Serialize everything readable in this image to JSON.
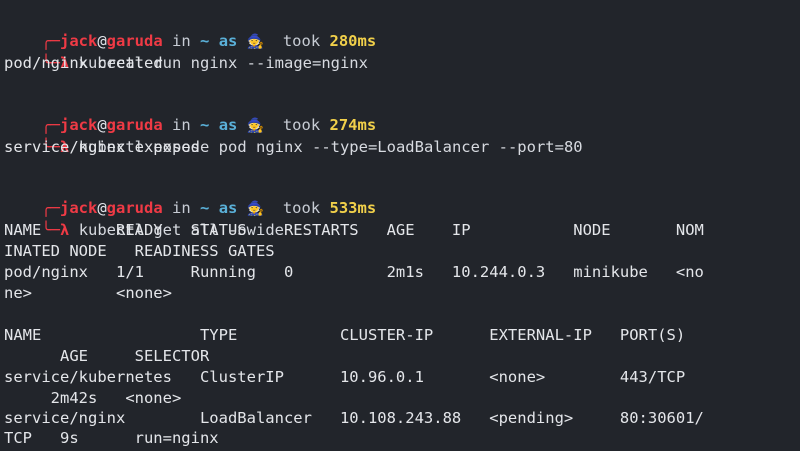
{
  "prompt": {
    "top_corner": "╭─",
    "bot_corner": "╰─",
    "user": "jack",
    "at": "@",
    "host": "garuda",
    "in_label": "in",
    "path": "~",
    "as_label": "as",
    "emoji": "🧙",
    "took_label": "took",
    "symbol": "λ"
  },
  "blocks": [
    {
      "duration": "280ms",
      "command": "kubectl run nginx --image=nginx",
      "output": [
        "pod/nginx created"
      ]
    },
    {
      "duration": "274ms",
      "command": "kubectl expose pod nginx --type=LoadBalancer --port=80",
      "output": [
        "service/nginx exposed"
      ]
    },
    {
      "duration": "533ms",
      "command": "kubectl get all -owide",
      "output": [
        "NAME        READY   STATUS    RESTARTS   AGE    IP           NODE       NOM",
        "INATED NODE   READINESS GATES",
        "pod/nginx   1/1     Running   0          2m1s   10.244.0.3   minikube   <no",
        "ne>         <none>",
        "",
        "NAME                 TYPE           CLUSTER-IP      EXTERNAL-IP   PORT(S)",
        "      AGE     SELECTOR",
        "service/kubernetes   ClusterIP      10.96.0.1       <none>        443/TCP",
        "     2m42s   <none>",
        "service/nginx        LoadBalancer   10.108.243.88   <pending>     80:30601/",
        "TCP   9s      run=nginx"
      ]
    }
  ]
}
